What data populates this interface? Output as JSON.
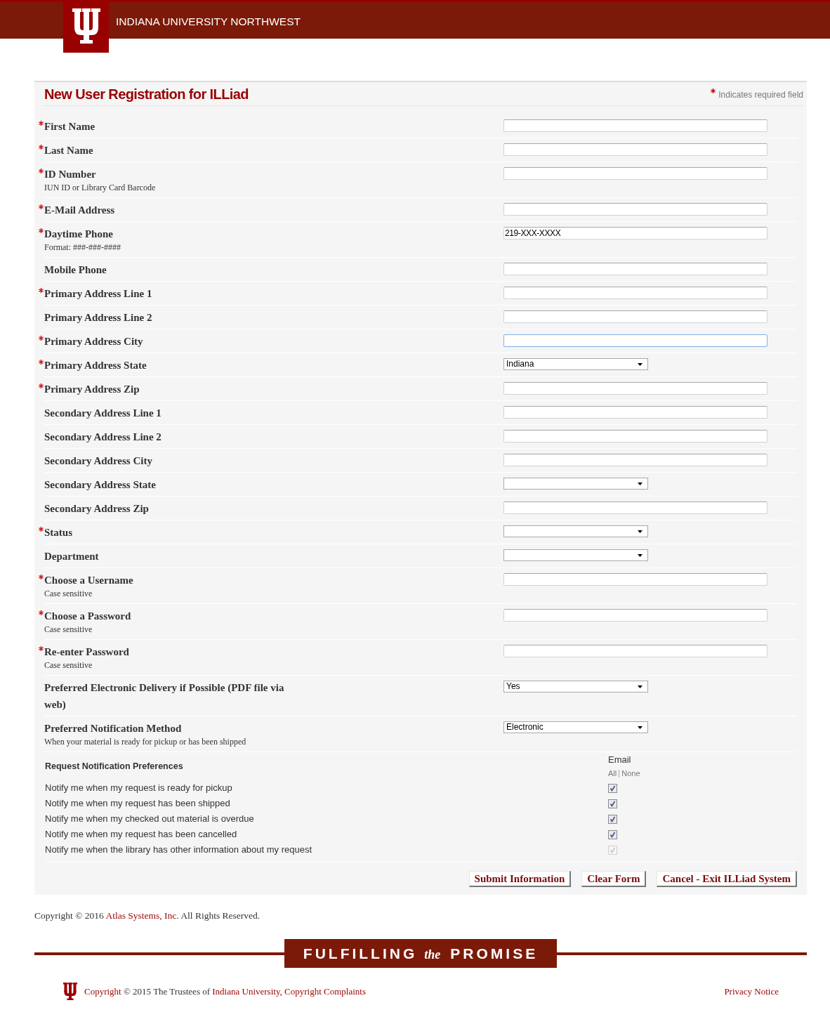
{
  "header": {
    "title": "INDIANA UNIVERSITY NORTHWEST"
  },
  "form": {
    "title": "New User Registration for ILLiad",
    "required_note": "Indicates required field",
    "fields": [
      {
        "kind": "text",
        "label": "First Name",
        "required": true,
        "focused": false
      },
      {
        "kind": "text",
        "label": "Last Name",
        "required": true,
        "focused": false
      },
      {
        "kind": "text",
        "label": "ID Number",
        "note": "IUN ID or Library Card Barcode",
        "required": true,
        "focused": false
      },
      {
        "kind": "text",
        "label": "E-Mail Address",
        "required": true,
        "focused": false
      },
      {
        "kind": "text",
        "label": "Daytime Phone",
        "note": "Format: ###-###-####",
        "value": "219-XXX-XXXX",
        "required": true,
        "focused": false
      },
      {
        "kind": "text",
        "label": "Mobile Phone",
        "required": false,
        "focused": false
      },
      {
        "kind": "text",
        "label": "Primary Address Line 1",
        "required": true,
        "focused": false
      },
      {
        "kind": "text",
        "label": "Primary Address Line 2",
        "required": false,
        "focused": false
      },
      {
        "kind": "text",
        "label": "Primary Address City",
        "required": true,
        "focused": true
      },
      {
        "kind": "select",
        "label": "Primary Address State",
        "value": "Indiana",
        "required": true,
        "focused": false
      },
      {
        "kind": "text",
        "label": "Primary Address Zip",
        "required": true,
        "focused": false
      },
      {
        "kind": "text",
        "label": "Secondary Address Line 1",
        "required": false,
        "focused": false
      },
      {
        "kind": "text",
        "label": "Secondary Address Line 2",
        "required": false,
        "focused": false
      },
      {
        "kind": "text",
        "label": "Secondary Address City",
        "required": false,
        "focused": false
      },
      {
        "kind": "select",
        "label": "Secondary Address State",
        "required": false,
        "focused": false
      },
      {
        "kind": "text",
        "label": "Secondary Address Zip",
        "required": false,
        "focused": false
      },
      {
        "kind": "select",
        "label": "Status",
        "required": true,
        "focused": false
      },
      {
        "kind": "select",
        "label": "Department",
        "required": false,
        "focused": false
      },
      {
        "kind": "text",
        "label": "Choose a Username",
        "note": "Case sensitive",
        "required": true,
        "focused": false
      },
      {
        "kind": "text",
        "label": "Choose a Password",
        "note": "Case sensitive",
        "required": true,
        "focused": false
      },
      {
        "kind": "text",
        "label": "Re-enter Password",
        "note": "Case sensitive",
        "required": true,
        "focused": false
      },
      {
        "kind": "select",
        "label": "Preferred Electronic Delivery if Possible (PDF file via web)",
        "value": "Yes",
        "required": false,
        "focused": false
      },
      {
        "kind": "select",
        "label": "Preferred Notification Method",
        "note": "When your material is ready for pickup or has been shipped",
        "value": "Electronic",
        "required": false,
        "focused": false
      }
    ]
  },
  "notifications": {
    "title": "Request Notification Preferences",
    "column": "Email",
    "all_link": "All",
    "none_link": "None",
    "items": [
      {
        "label": "Notify me when my request is ready for pickup",
        "checked": true,
        "disabled": false
      },
      {
        "label": "Notify me when my request has been shipped",
        "checked": true,
        "disabled": false
      },
      {
        "label": "Notify me when my checked out material is overdue",
        "checked": true,
        "disabled": false
      },
      {
        "label": "Notify me when my request has been cancelled",
        "checked": true,
        "disabled": false
      },
      {
        "label": "Notify me when the library has other information about my request",
        "checked": true,
        "disabled": true
      }
    ]
  },
  "buttons": [
    "Submit Information",
    "Clear Form",
    "Cancel - Exit ILLiad System"
  ],
  "copyright": {
    "segments": [
      {
        "kind": "text",
        "text": "Copyright © 2016"
      },
      {
        "kind": "link",
        "text": "Atlas Systems, Inc."
      },
      {
        "kind": "text",
        "text": "All Rights Reserved."
      }
    ]
  },
  "slogan": {
    "segments": [
      {
        "kind": "caps",
        "text": "FULFILLING"
      },
      {
        "kind": "script",
        "text": "the"
      },
      {
        "kind": "caps",
        "text": "PROMISE"
      }
    ]
  },
  "footer": {
    "segments": [
      {
        "kind": "link",
        "text": "Copyright"
      },
      {
        "kind": "text",
        "text": "© 2015 The Trustees of"
      },
      {
        "kind": "link",
        "text": "Indiana University,"
      },
      {
        "kind": "link",
        "text": "Copyright Complaints"
      }
    ],
    "privacy_link": "Privacy Notice"
  }
}
